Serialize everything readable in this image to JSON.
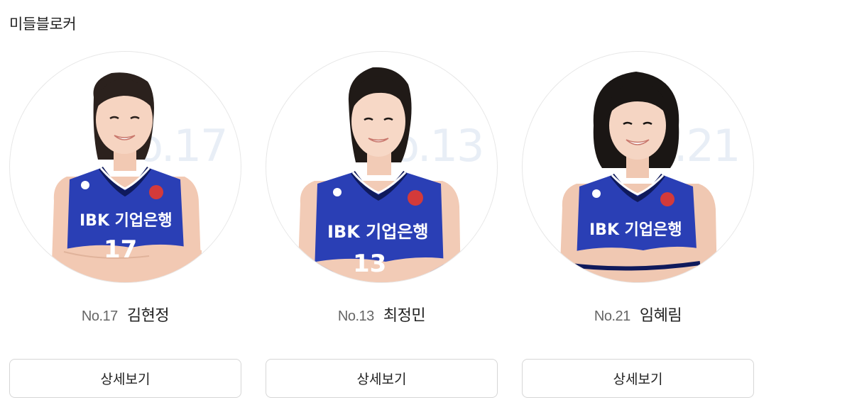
{
  "section": {
    "title": "미들블로커"
  },
  "players": [
    {
      "number_label": "No.17",
      "bg_number": "o.17",
      "name": "김현정",
      "jersey_sponsor": "IBK 기업은행",
      "jersey_number": "17",
      "button_label": "상세보기",
      "hair": "ponytail"
    },
    {
      "number_label": "No.13",
      "bg_number": "o.13",
      "name": "최정민",
      "jersey_sponsor": "IBK 기업은행",
      "jersey_number": "13",
      "button_label": "상세보기",
      "hair": "ponytail"
    },
    {
      "number_label": "No.21",
      "bg_number": "o.21",
      "name": "임혜림",
      "jersey_sponsor": "IBK 기업은행",
      "jersey_number": "",
      "button_label": "상세보기",
      "hair": "bob"
    }
  ],
  "colors": {
    "jersey_blue": "#2a3fb5",
    "jersey_trim": "#0f1a5c",
    "bg_number": "#e8eef6",
    "button_border": "#d6d6d6"
  }
}
